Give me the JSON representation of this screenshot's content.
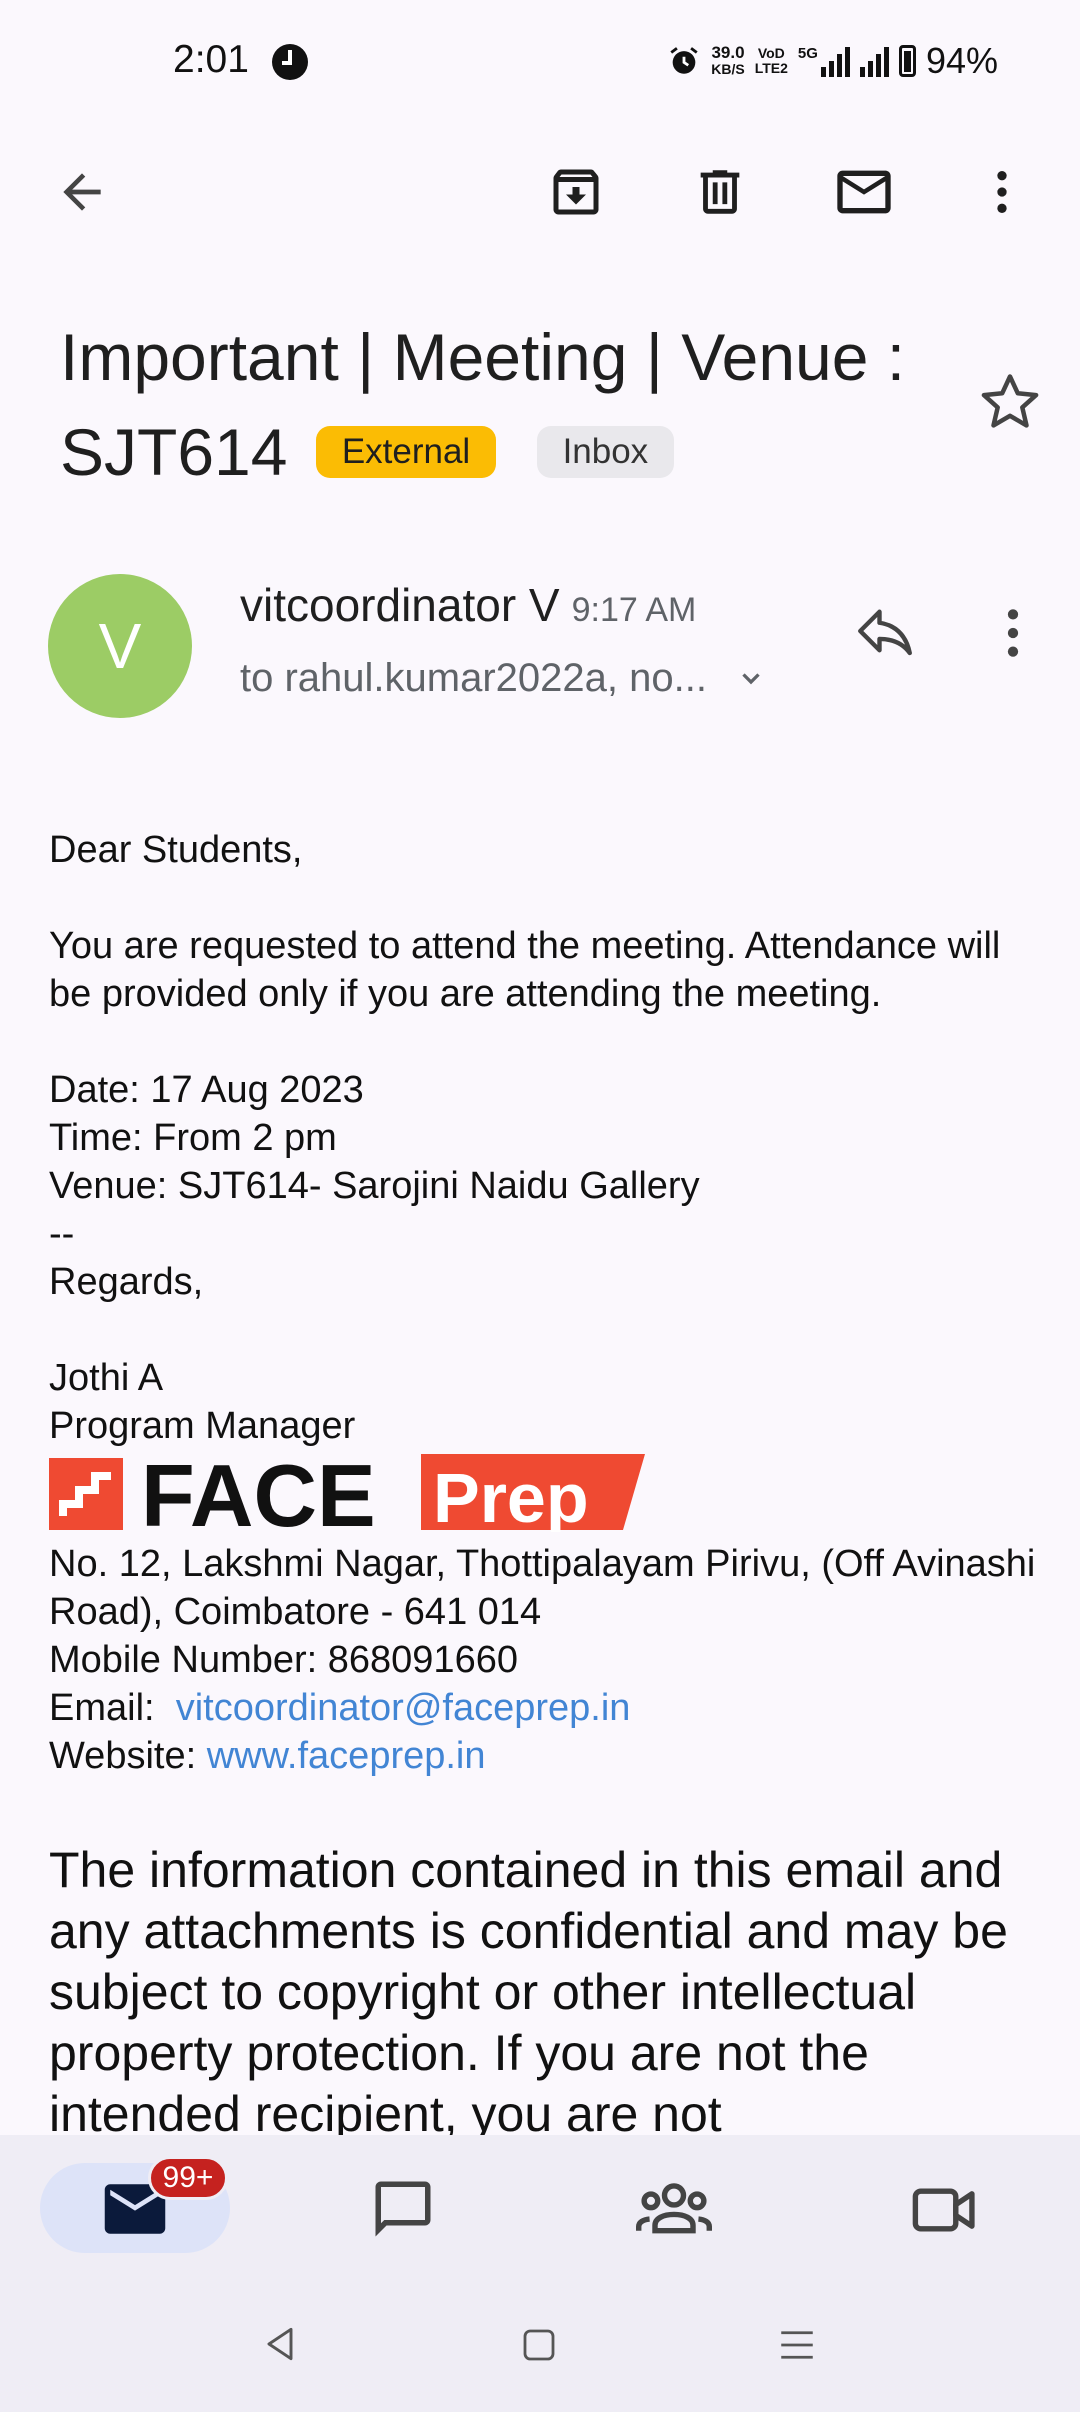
{
  "status_bar": {
    "time": "2:01",
    "net_speed_top": "39.0",
    "net_speed_unit": "KB/S",
    "volte_top": "VoD",
    "volte_bottom": "LTE2",
    "network": "5G",
    "battery": "94%"
  },
  "toolbar": {
    "icons": [
      "back-arrow-icon",
      "archive-icon",
      "delete-icon",
      "mark-unread-icon",
      "more-vert-icon"
    ]
  },
  "email": {
    "subject": "Important | Meeting | Venue : SJT614",
    "label_external": "External",
    "label_inbox": "Inbox",
    "avatar_letter": "V",
    "sender_name": "vitcoordinator V",
    "sent_time": "9:17 AM",
    "recipients": "to rahul.kumar2022a, no...",
    "body": "Dear Students,\n\nYou are requested to attend the meeting. Attendance will be provided only if you are attending the meeting.\n\nDate: 17 Aug 2023\nTime: From 2 pm\nVenue: SJT614- Sarojini Naidu Gallery\n--\nRegards,\n\nJothi A\nProgram Manager",
    "logo_text_face": "FACE",
    "logo_text_prep": "Prep",
    "address_line": "No. 12, Lakshmi Nagar, Thottipalayam Pirivu, (Off Avinashi Road), Coimbatore - 641 014",
    "mobile_line": "Mobile Number: 868091660",
    "email_label": "Email:",
    "email_link": "vitcoordinator@faceprep.in",
    "website_label": "Website:",
    "website_link": "www.faceprep.in",
    "disclaimer": "The information contained in this email and any attachments is confidential and may be subject to copyright or other intellectual property protection. If you are not the intended recipient, you are not"
  },
  "bottom_nav": {
    "mail_badge": "99+",
    "items": [
      "mail-icon",
      "chat-icon",
      "spaces-icon",
      "meet-icon"
    ]
  },
  "colors": {
    "avatar": "#9ccc65",
    "external_chip": "#fbbc04",
    "link": "#4285d4",
    "badge": "#c5221f",
    "face_prep_red": "#ef4a32"
  }
}
